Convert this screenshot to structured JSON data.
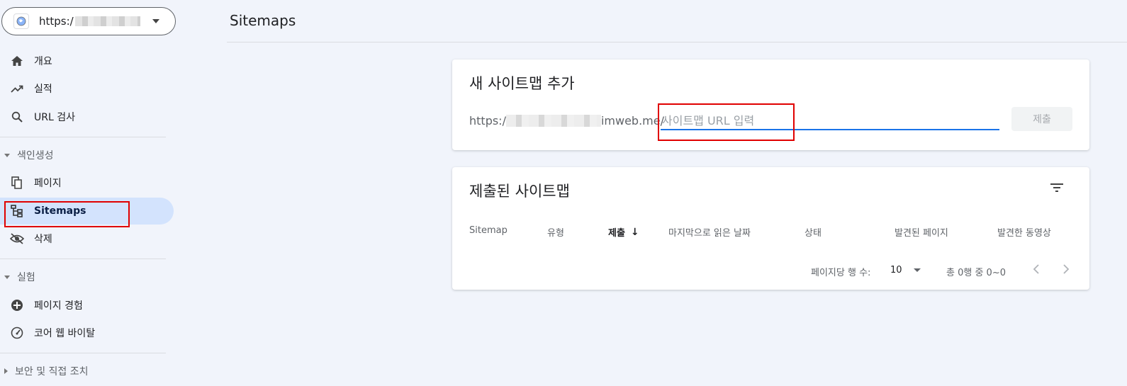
{
  "sidebar": {
    "property_url": "https:/",
    "items": [
      {
        "label": "개요",
        "icon": "home-icon"
      },
      {
        "label": "실적",
        "icon": "trending-up-icon"
      },
      {
        "label": "URL 검사",
        "icon": "search-icon"
      },
      {
        "label": "페이지",
        "icon": "pages-icon"
      },
      {
        "label": "Sitemaps",
        "icon": "sitemap-icon"
      },
      {
        "label": "삭제",
        "icon": "eye-off-icon"
      },
      {
        "label": "페이지 경험",
        "icon": "plus-circle-icon"
      },
      {
        "label": "코어 웹 바이탈",
        "icon": "speedometer-icon"
      }
    ],
    "sections": {
      "indexing": "색인생성",
      "experience": "실험",
      "security": "보안 및 직접 조치"
    }
  },
  "header": {
    "title": "Sitemaps"
  },
  "add_sitemap": {
    "title": "새 사이트맵 추가",
    "prefix_start": "https:/",
    "prefix_end": "imweb.me/",
    "placeholder": "사이트맵 URL 입력",
    "submit_label": "제출"
  },
  "submitted": {
    "title": "제출된 사이트맵",
    "columns": [
      "Sitemap",
      "유형",
      "제출",
      "마지막으로 읽은 날짜",
      "상태",
      "발견된 페이지",
      "발견한 동영상"
    ],
    "sort_indicator": "↓",
    "rows_per_page_label": "페이지당 행 수:",
    "rows_per_page_value": "10",
    "range_text": "총 0행 중 0~0"
  },
  "colors": {
    "accent": "#1a73e8",
    "active_bg": "#d3e3fd",
    "highlight": "#e00000"
  }
}
